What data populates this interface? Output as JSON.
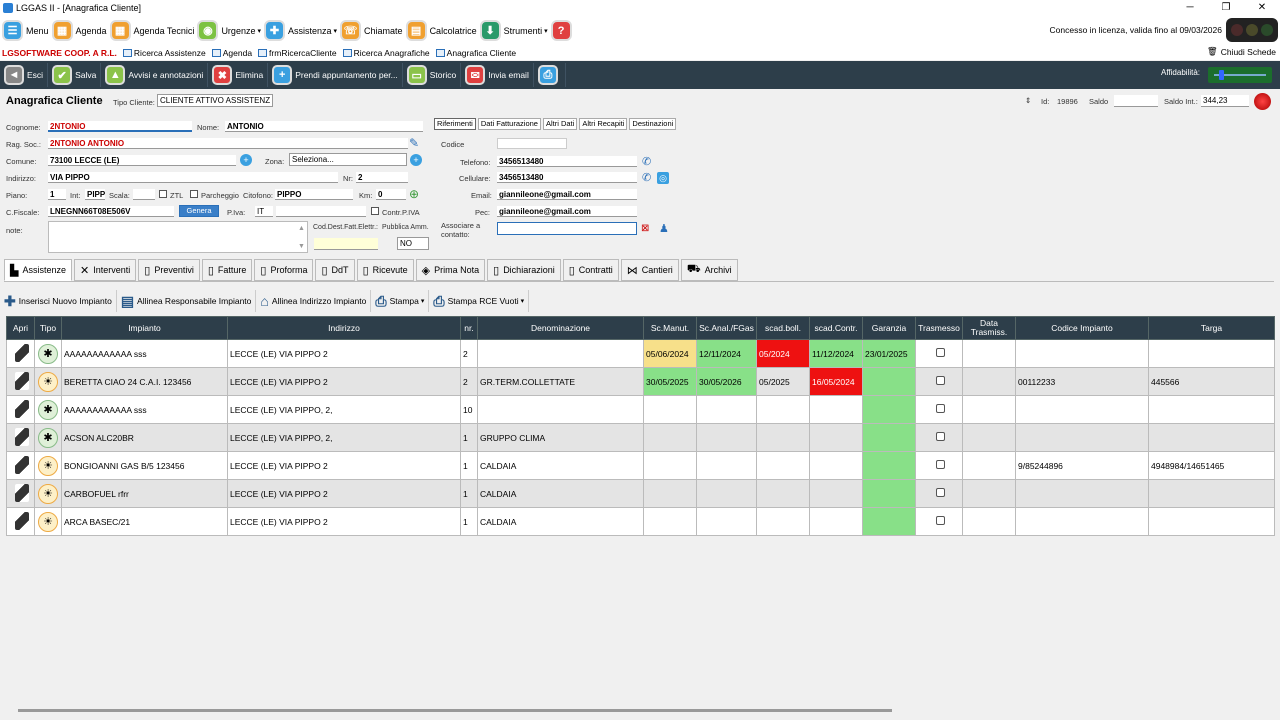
{
  "window": {
    "title": "LGGAS II - [Anagrafica Cliente]",
    "min": "─",
    "max": "❐",
    "close": "✕"
  },
  "menu": {
    "items": [
      {
        "label": "Menu",
        "color": "#3aa0e0",
        "icon": "☰",
        "caret": ""
      },
      {
        "label": "Agenda",
        "color": "#f0a030",
        "icon": "▦",
        "caret": ""
      },
      {
        "label": "Agenda Tecnici",
        "color": "#f0a030",
        "icon": "▦",
        "caret": ""
      },
      {
        "label": "Urgenze",
        "color": "#7cc242",
        "icon": "◉",
        "caret": "▾"
      },
      {
        "label": "Assistenza",
        "color": "#3aa0e0",
        "icon": "✚",
        "caret": "▾"
      },
      {
        "label": "Chiamate",
        "color": "#f0a030",
        "icon": "☏",
        "caret": ""
      },
      {
        "label": "Calcolatrice",
        "color": "#f0a030",
        "icon": "▤",
        "caret": ""
      },
      {
        "label": "Strumenti",
        "color": "#2a9a6a",
        "icon": "⬇",
        "caret": "▾"
      },
      {
        "label": "",
        "color": "#e04040",
        "icon": "?",
        "caret": ""
      }
    ],
    "license": "Concesso in licenza, valida fino al 09/03/2026"
  },
  "tabs": {
    "brand": "LGSOFTWARE COOP. A R.L.",
    "items": [
      "Ricerca Assistenze",
      "Agenda",
      "frmRicercaCliente",
      "Ricerca Anagrafiche",
      "Anagrafica Cliente"
    ],
    "close_all": "Chiudi Schede"
  },
  "actions": {
    "items": [
      {
        "label": "Esci",
        "color": "#888",
        "icon": "◄"
      },
      {
        "label": "Salva",
        "color": "#8bc34a",
        "icon": "✔"
      },
      {
        "label": "Avvisi e annotazioni",
        "color": "#8bc34a",
        "icon": "▲"
      },
      {
        "label": "Elimina",
        "color": "#e04040",
        "icon": "✖"
      },
      {
        "label": "Prendi appuntamento per...",
        "color": "#3aa0e0",
        "icon": "+"
      },
      {
        "label": "Storico",
        "color": "#8bc34a",
        "icon": "▭"
      },
      {
        "label": "Invia email",
        "color": "#e04040",
        "icon": "✉"
      },
      {
        "label": "",
        "color": "#3aa0e0",
        "icon": "⎙"
      }
    ],
    "affidabilita": "Affidabilità:",
    "affidabilita_level": 0.1
  },
  "client": {
    "heading": "Anagrafica Cliente",
    "tipo_label": "Tipo Cliente:",
    "tipo_value": "CLIENTE ATTIVO ASSISTENZ",
    "id_label": "Id:",
    "id": "19896",
    "saldo_label": "Saldo",
    "saldo": "",
    "saldo_int_label": "Saldo Int.:",
    "saldo_int": "344,23",
    "cognome_label": "Cognome:",
    "cognome": "2NTONIO",
    "nome_label": "Nome:",
    "nome": "ANTONIO",
    "ragsoc_label": "Rag. Soc.:",
    "ragsoc": "2NTONIO ANTONIO",
    "comune_label": "Comune:",
    "comune": "73100 LECCE (LE)",
    "zona_label": "Zona:",
    "zona": "Seleziona...",
    "indirizzo_label": "Indirizzo:",
    "indirizzo": "VIA PIPPO",
    "nr_label": "Nr:",
    "nr": "2",
    "piano_label": "Piano:",
    "piano": "1",
    "int_label": "Int:",
    "int": "PIPPO",
    "scala_label": "Scala:",
    "scala": "",
    "ztl_label": "ZTL",
    "parcheggio_label": "Parcheggio",
    "citofono_label": "Citofono:",
    "citofono": "PIPPO",
    "km_label": "Km:",
    "km": "0",
    "cf_label": "C.Fiscale:",
    "cf": "LNEGNN66T08E506V",
    "genera": "Genera",
    "piva_label": "P.Iva:",
    "piva_prefix": "IT",
    "piva": "",
    "contr_label": "Contr.P.IVA",
    "note_label": "note:",
    "note": "",
    "cod_dest_label": "Cod.Dest.Fatt.Elettr.:",
    "cod_dest": "",
    "pubblica_label": "Pubblica Amm.",
    "pubblica": "NO",
    "ref_tabs": [
      "Riferimenti",
      "Dati Fatturazione",
      "Altri Dati",
      "Altri Recapiti",
      "Destinazioni"
    ],
    "codice_label": "Codice",
    "codice": "",
    "telefono_label": "Telefono:",
    "telefono": "3456513480",
    "cellulare_label": "Cellulare:",
    "cellulare": "3456513480",
    "email_label": "Email:",
    "email": "giannileone@gmail.com",
    "pec_label": "Pec:",
    "pec": "giannileone@gmail.com",
    "assoc_label": "Associare a contatto:",
    "assoc": ""
  },
  "module_tabs": [
    {
      "label": "Assistenze",
      "icon": "▙"
    },
    {
      "label": "Interventi",
      "icon": "✕"
    },
    {
      "label": "Preventivi",
      "icon": "▯"
    },
    {
      "label": "Fatture",
      "icon": "▯"
    },
    {
      "label": "Proforma",
      "icon": "▯"
    },
    {
      "label": "DdT",
      "icon": "▯"
    },
    {
      "label": "Ricevute",
      "icon": "▯"
    },
    {
      "label": "Prima Nota",
      "icon": "◈"
    },
    {
      "label": "Dichiarazioni",
      "icon": "▯"
    },
    {
      "label": "Contratti",
      "icon": "▯"
    },
    {
      "label": "Cantieri",
      "icon": "⋈"
    },
    {
      "label": "Archivi",
      "icon": "⛟"
    }
  ],
  "sub_actions": [
    {
      "label": "Inserisci Nuovo Impianto",
      "icon": "✚",
      "caret": ""
    },
    {
      "label": "Allinea Responsabile Impianto",
      "icon": "▤",
      "caret": ""
    },
    {
      "label": "Allinea Indirizzo Impianto",
      "icon": "⌂",
      "caret": ""
    },
    {
      "label": "Stampa",
      "icon": "⎙",
      "caret": "▾"
    },
    {
      "label": "Stampa RCE Vuoti",
      "icon": "⎙",
      "caret": "▾"
    }
  ],
  "grid": {
    "headers": [
      "Apri",
      "Tipo",
      "Impianto",
      "Indirizzo",
      "nr.",
      "Denominazione",
      "Sc.Manut.",
      "Sc.Anal./FGas",
      "scad.boll.",
      "scad.Contr.",
      "Garanzia",
      "Trasmesso",
      "Data Trasmiss.",
      "Codice Impianto",
      "Targa"
    ],
    "rows": [
      {
        "tipo": "green",
        "impianto": "AAAAAAAAAAAA sss",
        "indirizzo": "LECCE (LE) VIA PIPPO 2",
        "nr": "2",
        "den": "",
        "manut": "05/06/2024",
        "anal": "12/11/2024",
        "boll": "05/2024",
        "contr": "11/12/2024",
        "gar": "23/01/2025",
        "codice": "",
        "targa": ""
      },
      {
        "tipo": "sun",
        "impianto": "BERETTA CIAO 24 C.A.I. 123456",
        "indirizzo": "LECCE (LE) VIA PIPPO 2",
        "nr": "2",
        "den": "GR.TERM.COLLETTATE",
        "manut": "30/05/2025",
        "anal": "30/05/2026",
        "boll": "05/2025",
        "contr": "16/05/2024",
        "gar": "",
        "codice": "00112233",
        "targa": "445566"
      },
      {
        "tipo": "green",
        "impianto": "AAAAAAAAAAAA sss",
        "indirizzo": "LECCE (LE) VIA PIPPO, 2,",
        "nr": "10",
        "den": "",
        "manut": "",
        "anal": "",
        "boll": "",
        "contr": "",
        "gar": "",
        "codice": "",
        "targa": ""
      },
      {
        "tipo": "green",
        "impianto": "ACSON ALC20BR",
        "indirizzo": "LECCE (LE) VIA PIPPO, 2,",
        "nr": "1",
        "den": "GRUPPO CLIMA",
        "manut": "",
        "anal": "",
        "boll": "",
        "contr": "",
        "gar": "",
        "codice": "",
        "targa": ""
      },
      {
        "tipo": "sun",
        "impianto": "BONGIOANNI GAS B/5 123456",
        "indirizzo": "LECCE (LE) VIA PIPPO 2",
        "nr": "1",
        "den": "CALDAIA",
        "manut": "",
        "anal": "",
        "boll": "",
        "contr": "",
        "gar": "",
        "codice": "9/85244896",
        "targa": "4948984/14651465"
      },
      {
        "tipo": "sun",
        "impianto": "CARBOFUEL rfrr",
        "indirizzo": "LECCE (LE) VIA PIPPO 2",
        "nr": "1",
        "den": "CALDAIA",
        "manut": "",
        "anal": "",
        "boll": "",
        "contr": "",
        "gar": "",
        "codice": "",
        "targa": ""
      },
      {
        "tipo": "sun",
        "impianto": "ARCA BASEC/21",
        "indirizzo": "LECCE (LE) VIA PIPPO 2",
        "nr": "1",
        "den": "CALDAIA",
        "manut": "",
        "anal": "",
        "boll": "",
        "contr": "",
        "gar": "",
        "codice": "",
        "targa": ""
      }
    ]
  }
}
